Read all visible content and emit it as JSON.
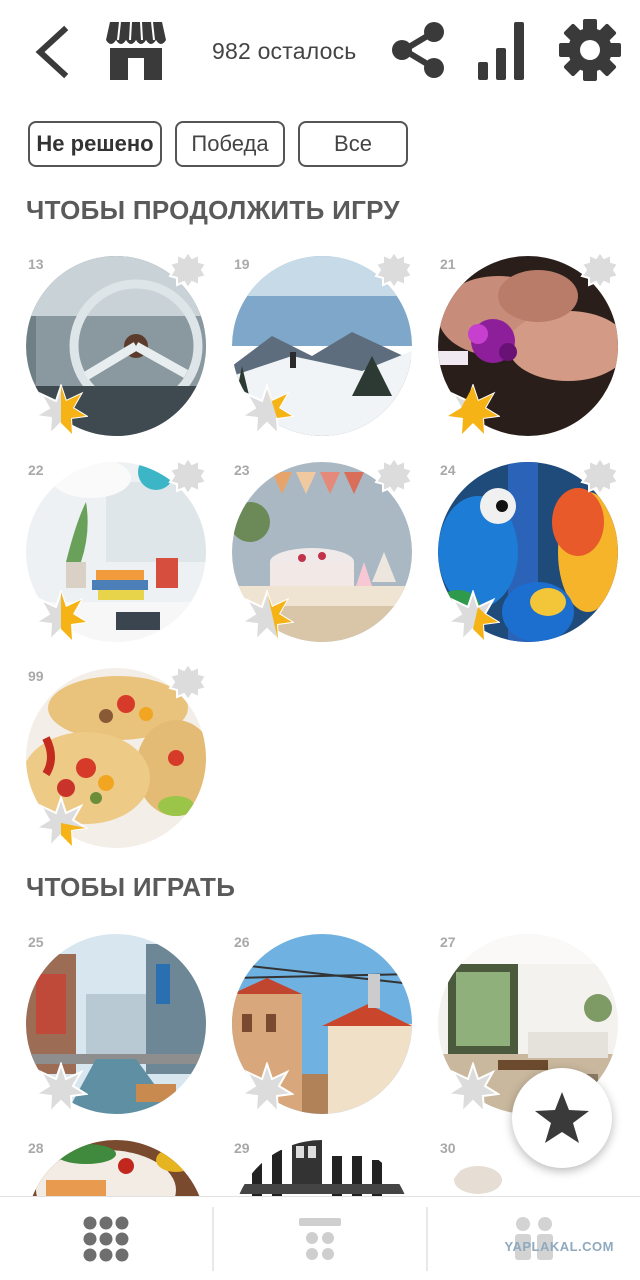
{
  "header": {
    "remaining_text": "982 осталось",
    "icons": [
      "back-arrow-icon",
      "shop-icon",
      "share-icon",
      "stats-bars-icon",
      "settings-gear-icon"
    ]
  },
  "filters": [
    {
      "label": "Не решено",
      "selected": true
    },
    {
      "label": "Победа",
      "selected": false
    },
    {
      "label": "Все",
      "selected": false
    }
  ],
  "sections": {
    "continue_title": "ЧТОБЫ ПРОДОЛЖИТЬ ИГРУ",
    "play_title": "ЧТОБЫ ИГРАТЬ"
  },
  "continue_puzzles": [
    {
      "number": "13",
      "subject": "vintage car steering wheel",
      "progress": 0.5
    },
    {
      "number": "19",
      "subject": "snowy mountain hiker",
      "progress": 0.4
    },
    {
      "number": "21",
      "subject": "hands holding gift",
      "progress": 0.7
    },
    {
      "number": "22",
      "subject": "desk with books and plants",
      "progress": 0.5
    },
    {
      "number": "23",
      "subject": "party cake table",
      "progress": 0.45
    },
    {
      "number": "24",
      "subject": "blue and gold macaws",
      "progress": 0.55
    },
    {
      "number": "99",
      "subject": "tacos",
      "progress": 0.35
    }
  ],
  "play_puzzles": [
    {
      "number": "25",
      "subject": "city canal",
      "progress": 0
    },
    {
      "number": "26",
      "subject": "european street with tram wires",
      "progress": 0
    },
    {
      "number": "27",
      "subject": "bright living room",
      "progress": 0
    },
    {
      "number": "28",
      "subject": "food plate",
      "progress": 0
    },
    {
      "number": "29",
      "subject": "black and white building",
      "progress": 0
    },
    {
      "number": "30",
      "subject": "interior",
      "progress": 0
    }
  ],
  "colors": {
    "accent_yellow": "#f5b316",
    "icon_dark": "#3a3a3a",
    "badge_grey": "#dcdcdc"
  },
  "fab": {
    "icon": "star-icon"
  },
  "bottom_nav": {
    "items": [
      {
        "icon": "grid-dots-icon"
      },
      {
        "icon": "pyramid-dots-icon"
      },
      {
        "icon": "people-icon"
      }
    ],
    "watermark": "YAPLAKAL.COM"
  }
}
